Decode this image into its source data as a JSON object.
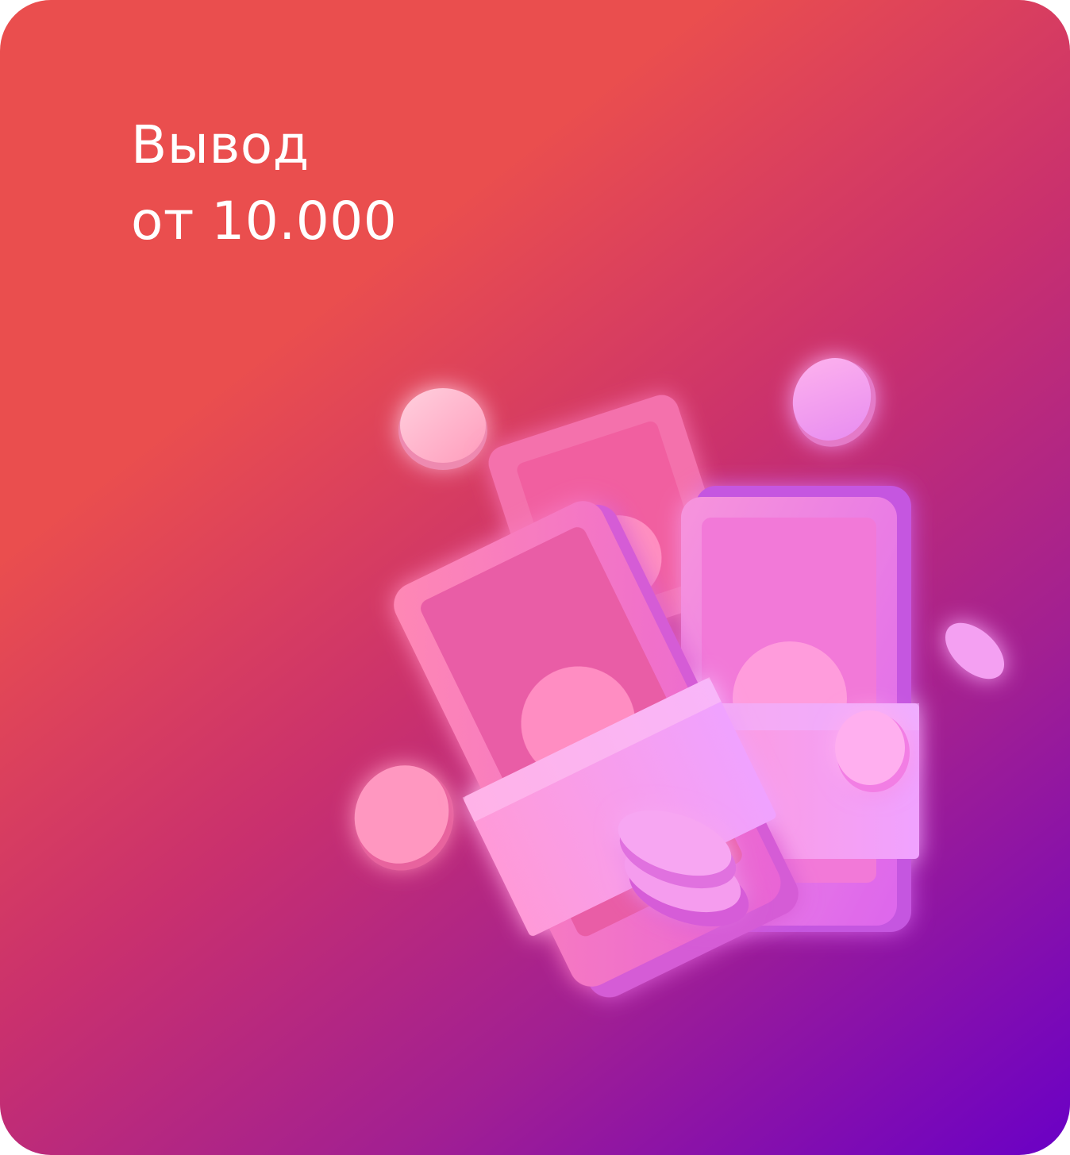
{
  "card": {
    "title_line1": "Вывод",
    "title_line2": "от 10.000"
  },
  "illustration": {
    "icon": "money-stacks-and-coins-icon"
  },
  "colors": {
    "gradient_start": "#ea4e4e",
    "gradient_mid": "#c9306e",
    "gradient_end": "#6a00c6",
    "text": "#ffffff"
  }
}
